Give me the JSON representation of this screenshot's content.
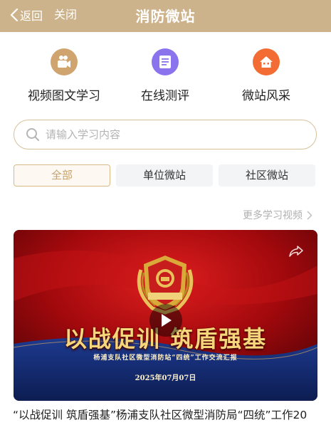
{
  "header": {
    "back_label": "返回",
    "close_label": "关闭",
    "title": "消防微站"
  },
  "features": [
    {
      "label": "视频图文学习",
      "icon": "video-camera-icon",
      "color": "#cfa46f"
    },
    {
      "label": "在线测评",
      "icon": "document-list-icon",
      "color": "#8b73ee"
    },
    {
      "label": "微站风采",
      "icon": "house-icon",
      "color": "#f26c33"
    }
  ],
  "search": {
    "placeholder": "请输入学习内容",
    "value": ""
  },
  "tabs": [
    {
      "label": "全部",
      "active": true
    },
    {
      "label": "单位微站",
      "active": false
    },
    {
      "label": "社区微站",
      "active": false
    }
  ],
  "more_link": "更多学习视频",
  "video": {
    "headline": "以战促训  筑盾强基",
    "subtitle": "杨浦支队社区微型消防站“四统”工作交流汇报",
    "date": "2025年07月07日",
    "caption": "“以战促训 筑盾强基”杨浦支队社区微型消防局“四统”工作20"
  },
  "colors": {
    "header": "#cdb38b",
    "accent": "#c9a16a",
    "search_border": "#d8c09a"
  }
}
